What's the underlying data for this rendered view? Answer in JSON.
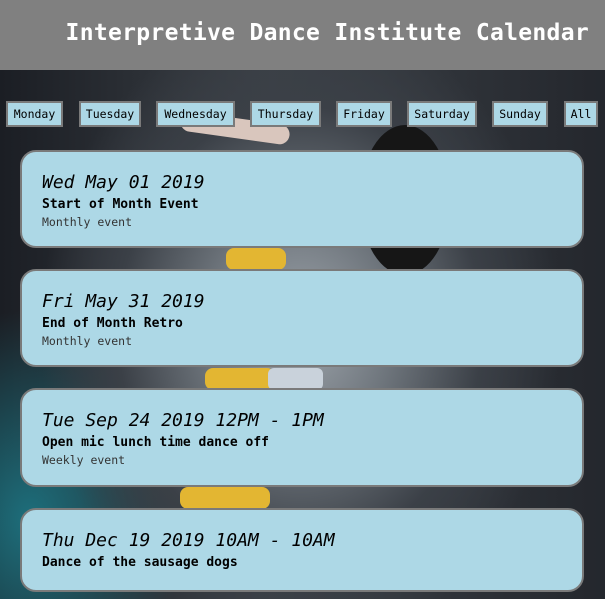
{
  "header": {
    "title": "Interpretive Dance Institute Calendar"
  },
  "filters": {
    "monday": "Monday",
    "tuesday": "Tuesday",
    "wednesday": "Wednesday",
    "thursday": "Thursday",
    "friday": "Friday",
    "saturday": "Saturday",
    "sunday": "Sunday",
    "all": "All"
  },
  "events": [
    {
      "date": "Wed May 01 2019",
      "name": "Start of Month Event",
      "frequency": "Monthly event"
    },
    {
      "date": "Fri May 31 2019",
      "name": "End of Month Retro",
      "frequency": "Monthly event"
    },
    {
      "date": "Tue Sep 24 2019 12PM - 1PM",
      "name": "Open mic lunch time dance off",
      "frequency": "Weekly event"
    },
    {
      "date": "Thu Dec 19 2019 10AM - 10AM",
      "name": "Dance of the sausage dogs",
      "frequency": ""
    }
  ],
  "colors": {
    "header_bg": "#808080",
    "card_bg": "#add8e6",
    "border": "#7a7a7a"
  }
}
